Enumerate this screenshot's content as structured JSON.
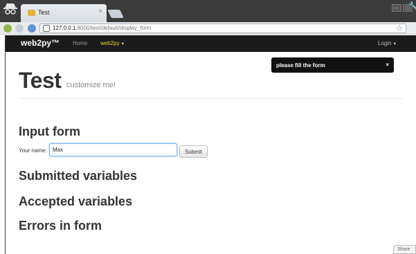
{
  "browser": {
    "tab_title": "Test",
    "tab_close": "×",
    "url_host": "127.0.0.1",
    "url_rest": ":8000/test/default/display_form",
    "bookmark_star": "☆",
    "window_minimize": "–",
    "window_maximize": "□"
  },
  "navbar": {
    "brand": "web2py™",
    "home": "Home",
    "web2py_menu": "web2py",
    "login": "Login"
  },
  "flash": {
    "message": "please fill the form",
    "close": "×"
  },
  "header": {
    "title": "Test",
    "subtitle": "customize me!"
  },
  "form": {
    "heading": "Input form",
    "name_label": "Your name:",
    "name_value": "Max",
    "submit_label": "Submit"
  },
  "sections": {
    "submitted": "Submitted variables",
    "accepted": "Accepted variables",
    "errors": "Errors in form"
  },
  "share_label": "Share",
  "colors": {
    "navbar_bg": "#1b1b1b",
    "brand_accent": "#e5d43a",
    "flash_bg": "#111111"
  }
}
